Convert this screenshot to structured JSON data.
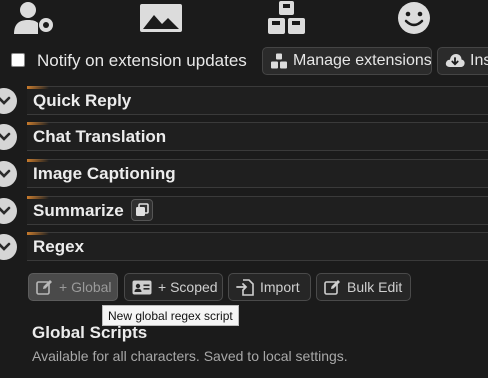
{
  "notify": {
    "checked": false,
    "label": "Notify on extension updates",
    "manage_label": "Manage extensions",
    "install_label": "Ins"
  },
  "top_icons": [
    "user-settings-icon",
    "image-icon",
    "cubes-icon",
    "smiley-icon"
  ],
  "drawers": [
    {
      "title": "Quick Reply"
    },
    {
      "title": "Chat Translation"
    },
    {
      "title": "Image Captioning"
    },
    {
      "title": "Summarize"
    },
    {
      "title": "Regex"
    }
  ],
  "regex": {
    "buttons": {
      "global": "+ Global",
      "scoped": "+ Scoped",
      "import": "Import",
      "bulk_edit": "Bulk Edit"
    },
    "tooltip": "New global regex script",
    "section_title": "Global Scripts",
    "section_desc": "Available for all characters. Saved to local settings."
  },
  "colors": {
    "background": "#1b1b1b",
    "accent": "#c77a2c",
    "active_button": "#4a4a4a"
  }
}
